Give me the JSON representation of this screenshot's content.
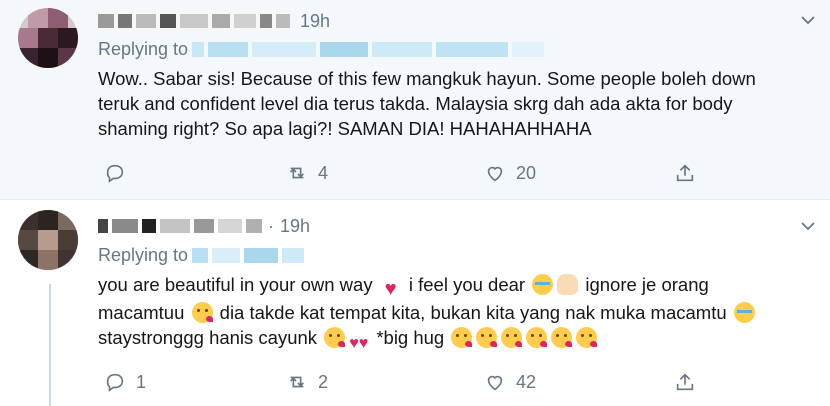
{
  "tweets": [
    {
      "time": "19h",
      "reply_prefix": "Replying to",
      "text": "Wow..  Sabar sis! Because of this few mangkuk hayun. Some people boleh down teruk and confident level dia terus takda. Malaysia skrg dah ada akta for body shaming right? So apa lagi?! SAMAN DIA! HAHAHAHHAHA",
      "counts": {
        "reply": "",
        "retweet": "4",
        "like": "20"
      }
    },
    {
      "time": "19h",
      "reply_prefix": "Replying to",
      "text_parts": [
        "you are beautiful in your own way",
        "i feel you dear",
        "ignore je orang macamtuu",
        "dia takde kat tempat kita, bukan kita yang nak muka macamtu",
        "staystronggg hanis cayunk",
        "*big hug"
      ],
      "counts": {
        "reply": "1",
        "retweet": "2",
        "like": "42"
      }
    }
  ],
  "icons": {
    "more": "chevron-down-icon",
    "reply": "reply-bubble-icon",
    "retweet": "retweet-icon",
    "like": "heart-icon",
    "share": "share-icon"
  },
  "colors": {
    "background_first": "#f5f8fa",
    "text": "#14171a",
    "muted": "#657786",
    "masked_handle": "#b9e0f2"
  }
}
